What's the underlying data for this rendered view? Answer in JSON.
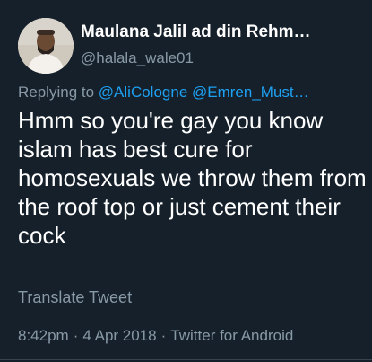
{
  "author": {
    "name": "Maulana Jalil ad din Rehm…",
    "handle": "@halala_wale01"
  },
  "reply": {
    "prefix": "Replying to",
    "mentions": [
      "@AliCologne",
      "@Emren_Must…"
    ]
  },
  "tweet": {
    "text": "Hmm so you're gay you know islam has best cure for homosexuals we throw them from the roof top or just cement their cock"
  },
  "translate_label": "Translate Tweet",
  "meta": {
    "time": "8:42pm",
    "date": "4 Apr 2018",
    "client": "Twitter for Android",
    "separator": "·"
  },
  "colors": {
    "background": "#15202b",
    "secondary_text": "#8899a6",
    "link": "#1da1f2"
  },
  "icons": [
    "avatar",
    "chevron-down-icon"
  ]
}
